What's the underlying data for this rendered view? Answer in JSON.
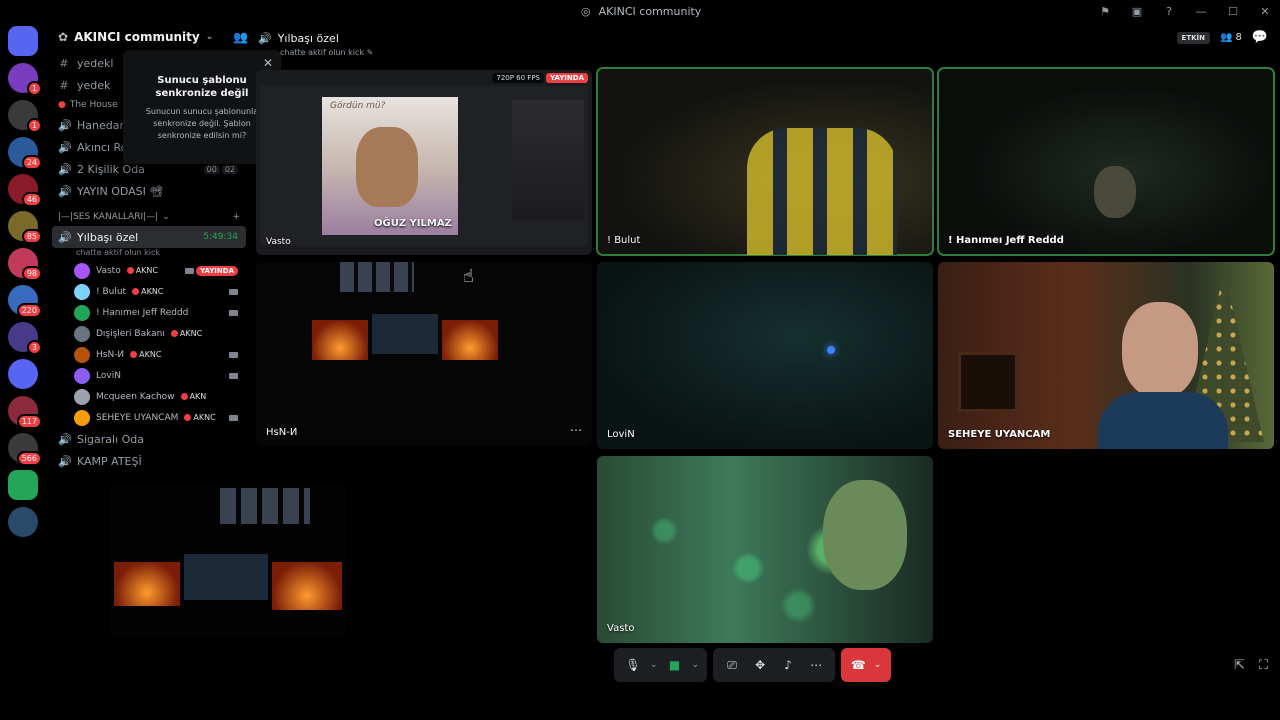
{
  "window": {
    "title": "AKINCI community"
  },
  "server": {
    "name": "AKINCI community"
  },
  "servers": [
    {
      "badge": ""
    },
    {
      "badge": "1"
    },
    {
      "badge": "1"
    },
    {
      "badge": "24"
    },
    {
      "badge": "46"
    },
    {
      "badge": "85"
    },
    {
      "badge": "98"
    },
    {
      "badge": "220"
    },
    {
      "badge": "3"
    },
    {
      "badge": ""
    },
    {
      "badge": "117"
    },
    {
      "badge": "566"
    },
    {
      "badge": ""
    },
    {
      "badge": ""
    }
  ],
  "sidebar": {
    "top_channels": [
      {
        "name": "yedekl",
        "icon": "#"
      },
      {
        "name": "yedek",
        "icon": "#"
      }
    ],
    "category_house": "The House",
    "house_channels": [
      {
        "name": "Hanedan Ka",
        "counts": []
      },
      {
        "name": "Akıncı Roo",
        "counts": []
      },
      {
        "name": "2 Kişilik Oda",
        "counts": [
          "00",
          "02"
        ]
      },
      {
        "name": "YAYIN ODASI 📽",
        "counts": []
      }
    ],
    "category_voice": "|—|SES KANALLARI|—|",
    "active_channel": {
      "name": "Yılbaşı özel",
      "timer": "5:49:34",
      "status": "chatte aktif olun kick"
    },
    "members": [
      {
        "name": "Vasto",
        "tag": "AKNC",
        "live": "YAYINDA",
        "cam": true
      },
      {
        "name": "! Bulut",
        "tag": "AKNC",
        "live": "",
        "cam": true
      },
      {
        "name": "! Hanımeı Jeff Reddd",
        "tag": "",
        "live": "",
        "cam": true
      },
      {
        "name": "Dışişleri Bakanı",
        "tag": "AKNC",
        "live": "",
        "cam": false
      },
      {
        "name": "HsN-И",
        "tag": "AKNC",
        "live": "",
        "cam": true
      },
      {
        "name": "LoviN",
        "tag": "",
        "live": "",
        "cam": true
      },
      {
        "name": "Mcqueen Kachow",
        "tag": "AKN",
        "live": "",
        "cam": false
      },
      {
        "name": "SEHEYE UYANCAM",
        "tag": "AKNC",
        "live": "",
        "cam": true
      }
    ],
    "bottom_channels": [
      "Sigaralı Oda",
      "KAMP ATEŞİ"
    ]
  },
  "tooltip": {
    "title": "Sunucu şablonu senkronize değil",
    "body": "Sunucun sunucu şablonunla senkronize değil. Şablon senkronize edilsin mi?"
  },
  "call": {
    "channel": "Yılbaşı özel",
    "status": "chatte aktif olun kick",
    "activity": "ETKİN",
    "participants_count": "8"
  },
  "stream": {
    "quality": "720P 60 FPS",
    "live": "YAYINDA",
    "album_text": "Gördün mü?",
    "album_artist": "OĞUZ YILMAZ",
    "streamer": "Vasto"
  },
  "tiles": [
    {
      "name": "! Bulut"
    },
    {
      "name": "! Hanımeı Jeff Reddd"
    },
    {
      "name": "HsN-И"
    },
    {
      "name": "LoviN"
    },
    {
      "name": "SEHEYE UYANCAM"
    },
    {
      "name": "Vasto"
    }
  ],
  "colors": {
    "accent_green": "#23a55a",
    "live_red": "#f23f43",
    "leave_red": "#da373c"
  }
}
